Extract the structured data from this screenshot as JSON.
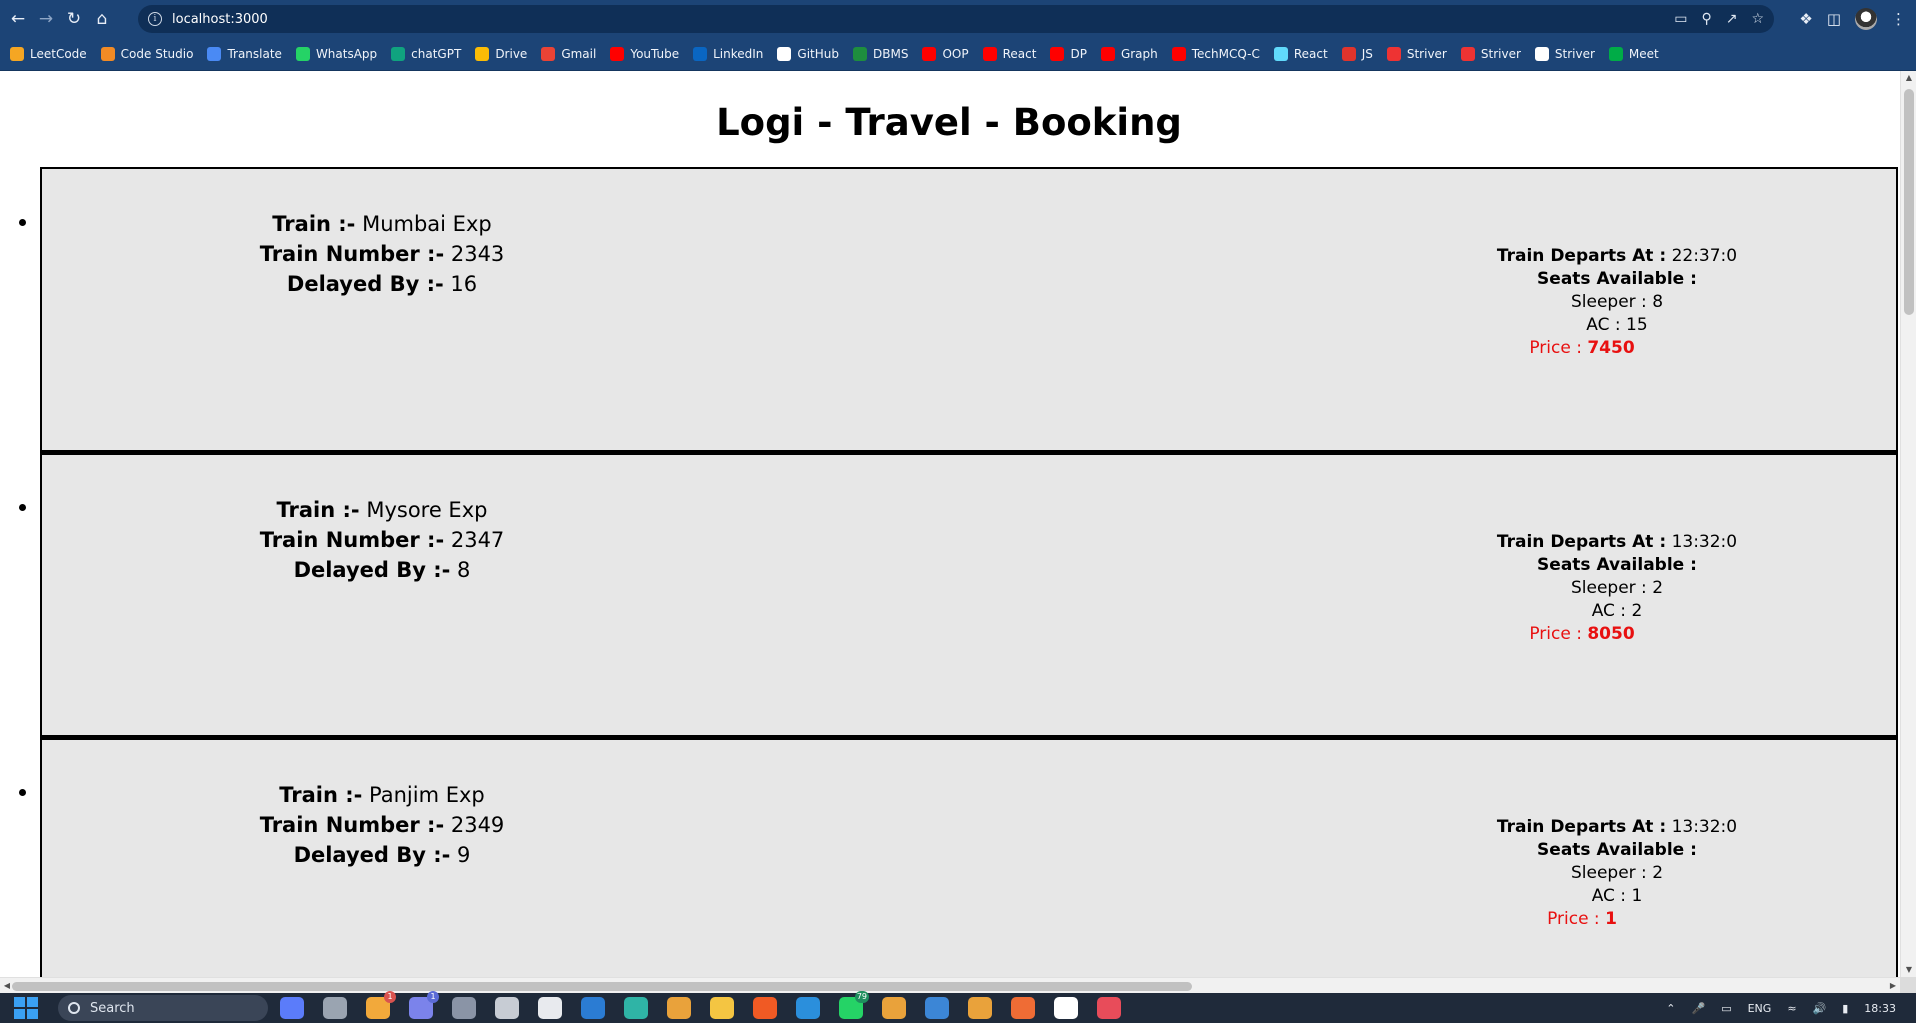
{
  "browser": {
    "url": "localhost:3000",
    "bookmarks": [
      {
        "label": "LeetCode",
        "icon": "leetcode-icon",
        "color": "#f5a623"
      },
      {
        "label": "Code Studio",
        "icon": "codestudio-icon",
        "color": "#f28b25"
      },
      {
        "label": "Translate",
        "icon": "translate-icon",
        "color": "#4a8af4"
      },
      {
        "label": "WhatsApp",
        "icon": "whatsapp-icon",
        "color": "#25d366"
      },
      {
        "label": "chatGPT",
        "icon": "chatgpt-icon",
        "color": "#10a37f"
      },
      {
        "label": "Drive",
        "icon": "drive-icon",
        "color": "#fbbc05"
      },
      {
        "label": "Gmail",
        "icon": "gmail-icon",
        "color": "#ea4335"
      },
      {
        "label": "YouTube",
        "icon": "youtube-icon",
        "color": "#ff0000"
      },
      {
        "label": "LinkedIn",
        "icon": "linkedin-icon",
        "color": "#0a66c2"
      },
      {
        "label": "GitHub",
        "icon": "github-icon",
        "color": "#ffffff"
      },
      {
        "label": "DBMS",
        "icon": "classroom-icon",
        "color": "#1e8e3e"
      },
      {
        "label": "OOP",
        "icon": "youtube-icon",
        "color": "#ff0000"
      },
      {
        "label": "React",
        "icon": "youtube-icon",
        "color": "#ff0000"
      },
      {
        "label": "DP",
        "icon": "youtube-icon",
        "color": "#ff0000"
      },
      {
        "label": "Graph",
        "icon": "youtube-icon",
        "color": "#ff0000"
      },
      {
        "label": "TechMCQ-C",
        "icon": "youtube-icon",
        "color": "#ff0000"
      },
      {
        "label": "React",
        "icon": "react-icon",
        "color": "#61dafb"
      },
      {
        "label": "JS",
        "icon": "js-icon",
        "color": "#e0342c"
      },
      {
        "label": "Striver",
        "icon": "striver-icon",
        "color": "#e33"
      },
      {
        "label": "Striver",
        "icon": "striver-icon",
        "color": "#e33"
      },
      {
        "label": "Striver",
        "icon": "globe-icon",
        "color": "#ffffff"
      },
      {
        "label": "Meet",
        "icon": "meet-icon",
        "color": "#00ac47"
      }
    ]
  },
  "page": {
    "title": "Logi - Travel - Booking",
    "labels": {
      "train": "Train :-",
      "train_number": "Train Number :-",
      "delayed_by": "Delayed By :-",
      "departs_at": "Train Departs At :",
      "seats_available": "Seats Available :",
      "sleeper": "Sleeper :",
      "ac": "AC :",
      "price": "Price :"
    },
    "trains": [
      {
        "name": "Mumbai Exp",
        "number": "2343",
        "delay": "16",
        "departs": "22:37:0",
        "sleeper": "8",
        "ac": "15",
        "price": "7450"
      },
      {
        "name": "Mysore Exp",
        "number": "2347",
        "delay": "8",
        "departs": "13:32:0",
        "sleeper": "2",
        "ac": "2",
        "price": "8050"
      },
      {
        "name": "Panjim Exp",
        "number": "2349",
        "delay": "9",
        "departs": "13:32:0",
        "sleeper": "2",
        "ac": "1",
        "price": "1"
      }
    ]
  },
  "taskbar": {
    "search_label": "Search",
    "language": "ENG",
    "time": "18:33",
    "apps": [
      {
        "icon": "copilot-icon",
        "color": "#5b7cfa",
        "badge": ""
      },
      {
        "icon": "file-icon",
        "color": "#9aa4b1",
        "badge": ""
      },
      {
        "icon": "widget-icon",
        "color": "#f2a93b",
        "badge": "1"
      },
      {
        "icon": "teams-icon",
        "color": "#7b83eb",
        "badge": "1"
      },
      {
        "icon": "settings-icon",
        "color": "#8a94a6",
        "badge": ""
      },
      {
        "icon": "hexagon-icon",
        "color": "#c7ccd4",
        "badge": ""
      },
      {
        "icon": "store-icon",
        "color": "#e8eaee",
        "badge": ""
      },
      {
        "icon": "todo-icon",
        "color": "#2b7cd3",
        "badge": ""
      },
      {
        "icon": "edge-icon",
        "color": "#2fb4a6",
        "badge": ""
      },
      {
        "icon": "chrome-icon",
        "color": "#e9a23b",
        "badge": ""
      },
      {
        "icon": "folder-icon",
        "color": "#f4c542",
        "badge": ""
      },
      {
        "icon": "brave-icon",
        "color": "#f05a24",
        "badge": ""
      },
      {
        "icon": "vscode-icon",
        "color": "#2b8fdc",
        "badge": ""
      },
      {
        "icon": "whatsapp-icon",
        "color": "#25d366",
        "badge": "79"
      },
      {
        "icon": "chrome-profile-icon",
        "color": "#e9a23b",
        "badge": ""
      },
      {
        "icon": "photos-icon",
        "color": "#3c86d6",
        "badge": ""
      },
      {
        "icon": "chrome-icon",
        "color": "#e9a23b",
        "badge": ""
      },
      {
        "icon": "postman-icon",
        "color": "#ef6c35",
        "badge": ""
      },
      {
        "icon": "github-desktop-icon",
        "color": "#ffffff",
        "badge": ""
      },
      {
        "icon": "snipping-icon",
        "color": "#e84c5a",
        "badge": ""
      }
    ]
  }
}
